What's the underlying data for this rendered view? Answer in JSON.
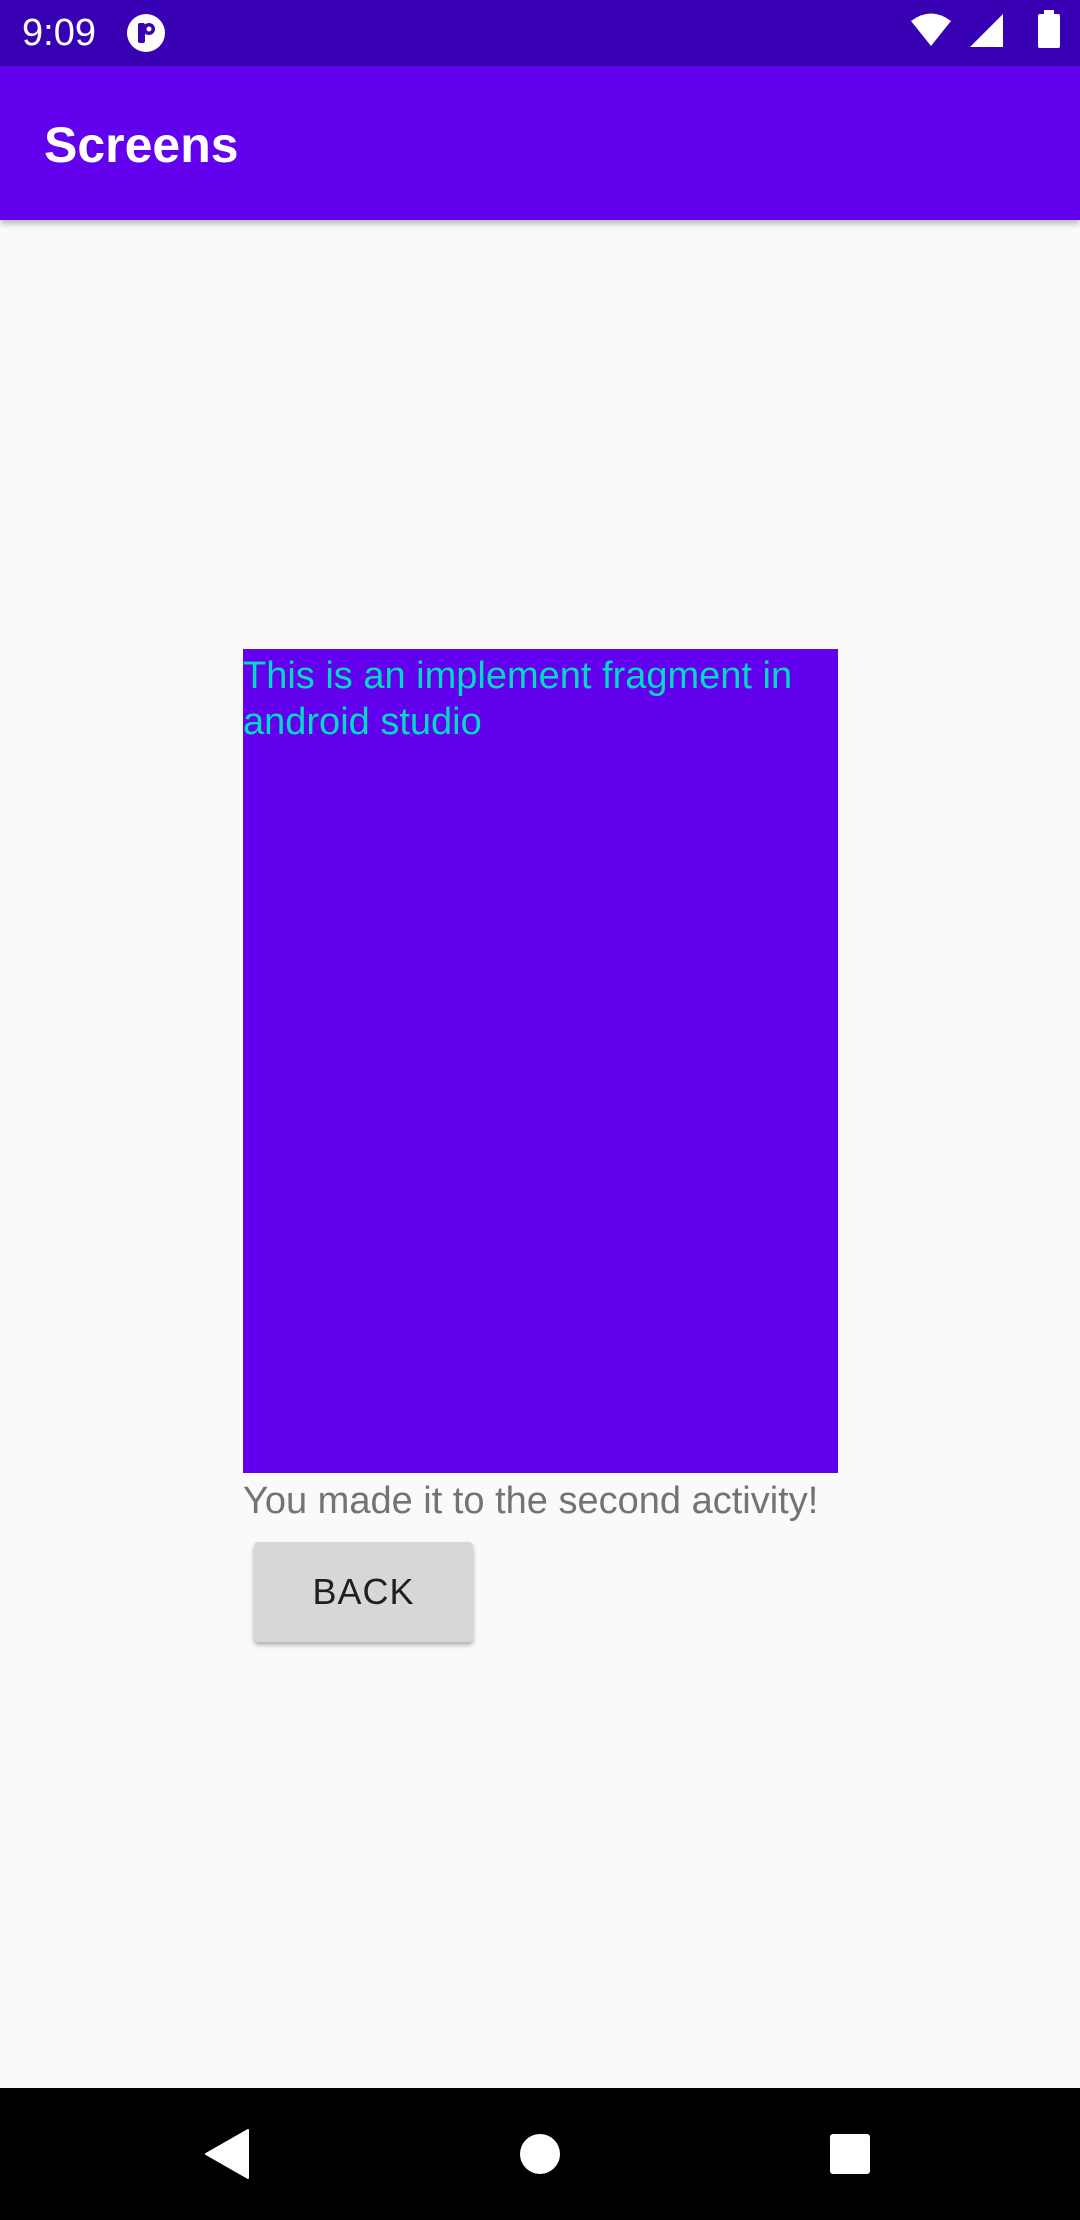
{
  "status_bar": {
    "time": "9:09",
    "app_icon": "pocket-casts-like-icon",
    "icons": [
      "wifi-icon",
      "cell-signal-icon",
      "battery-icon"
    ],
    "background": "#3700b3"
  },
  "app_bar": {
    "title": "Screens",
    "background": "#6200ee"
  },
  "fragment": {
    "text": "This is an implement fragment in android studio",
    "background": "#6200ee",
    "text_color": "#03dac5"
  },
  "main": {
    "message": "You made it to the second activity!",
    "back_label": "BACK"
  },
  "nav_bar": {
    "buttons": [
      "back-triangle-icon",
      "home-circle-icon",
      "recents-square-icon"
    ]
  }
}
